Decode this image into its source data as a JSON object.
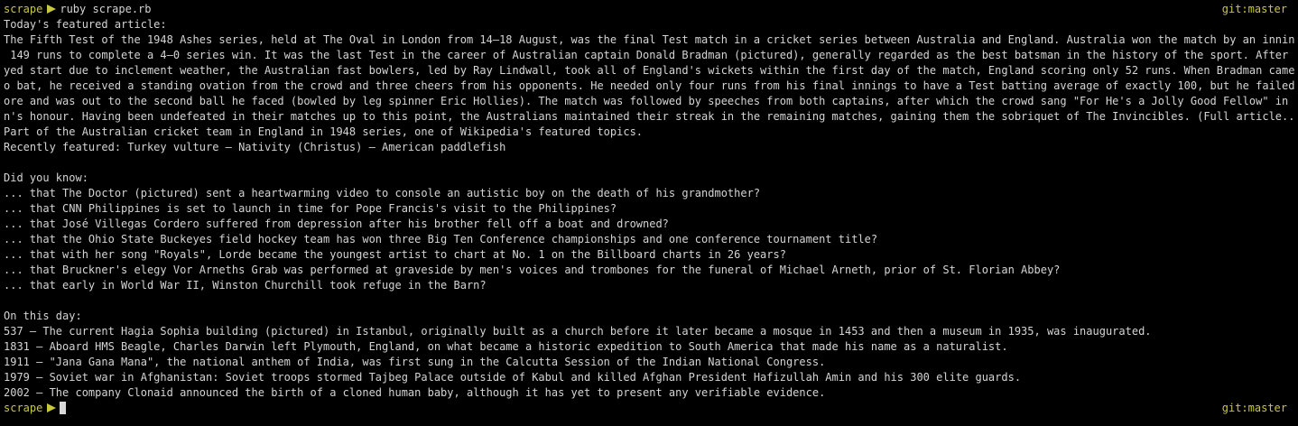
{
  "prompt": {
    "dir": "scrape",
    "command": "ruby scrape.rb",
    "git": "git:master",
    "accent": "#c8c83c"
  },
  "featured": {
    "heading": "Today's featured article:",
    "lines": [
      "The Fifth Test of the 1948 Ashes series, held at The Oval in London from 14–18 August, was the final Test match in a cricket series between Australia and England. Australia won the match by an innings and",
      " 149 runs to complete a 4–0 series win. It was the last Test in the career of Australian captain Donald Bradman (pictured), generally regarded as the best batsman in the history of the sport. After a dela",
      "yed start due to inclement weather, the Australian fast bowlers, led by Ray Lindwall, took all of England's wickets within the first day of the match, England scoring only 52 runs. When Bradman came out t",
      "o bat, he received a standing ovation from the crowd and three cheers from his opponents. He needed only four runs from his final innings to have a Test batting average of exactly 100, but he failed to sc",
      "ore and was out to the second ball he faced (bowled by leg spinner Eric Hollies). The match was followed by speeches from both captains, after which the crowd sang \"For He's a Jolly Good Fellow\" in Bradma",
      "n's honour. Having been undefeated in their matches up to this point, the Australians maintained their streak in the remaining matches, gaining them the sobriquet of The Invincibles. (Full article...)"
    ],
    "part": "Part of the Australian cricket team in England in 1948 series, one of Wikipedia's featured topics.",
    "recent": "Recently featured: Turkey vulture – Nativity (Christus) – American paddlefish"
  },
  "dyk": {
    "heading": "Did you know:",
    "items": [
      "... that The Doctor (pictured) sent a heartwarming video to console an autistic boy on the death of his grandmother?",
      "... that CNN Philippines is set to launch in time for Pope Francis's visit to the Philippines?",
      "... that José Villegas Cordero suffered from depression after his brother fell off a boat and drowned?",
      "... that the Ohio State Buckeyes field hockey team has won three Big Ten Conference championships and one conference tournament title?",
      "... that with her song \"Royals\", Lorde became the youngest artist to chart at No. 1 on the Billboard charts in 26 years?",
      "... that Bruckner's elegy Vor Arneths Grab was performed at graveside by men's voices and trombones for the funeral of Michael Arneth, prior of St. Florian Abbey?",
      "... that early in World War II, Winston Churchill took refuge in the Barn?"
    ]
  },
  "otd": {
    "heading": "On this day:",
    "items": [
      "537 – The current Hagia Sophia building (pictured) in Istanbul, originally built as a church before it later became a mosque in 1453 and then a museum in 1935, was inaugurated.",
      "1831 – Aboard HMS Beagle, Charles Darwin left Plymouth, England, on what became a historic expedition to South America that made his name as a naturalist.",
      "1911 – \"Jana Gana Mana\", the national anthem of India, was first sung in the Calcutta Session of the Indian National Congress.",
      "1979 – Soviet war in Afghanistan: Soviet troops stormed Tajbeg Palace outside of Kabul and killed Afghan President Hafizullah Amin and his 300 elite guards.",
      "2002 – The company Clonaid announced the birth of a cloned human baby, although it has yet to present any verifiable evidence."
    ]
  }
}
